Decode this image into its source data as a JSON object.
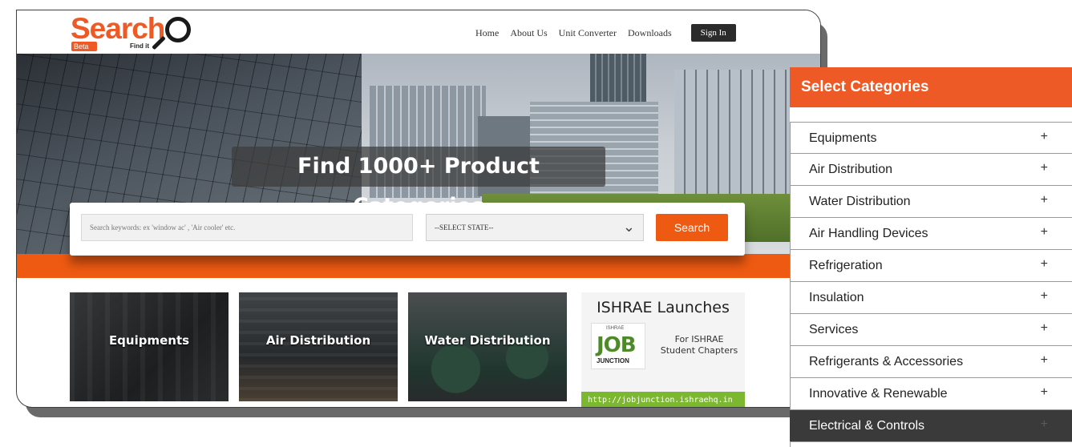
{
  "site": {
    "logo_text": "Search",
    "logo_badge": "Beta",
    "logo_tagline": "Find it"
  },
  "nav": {
    "items": [
      "Home",
      "About Us",
      "Unit Converter",
      "Downloads"
    ],
    "sign_in": "Sign In"
  },
  "hero": {
    "title": "Find 1000+ Product Categories"
  },
  "search": {
    "placeholder": "Search keywords: ex 'window ac' , 'Air cooler' etc.",
    "state_selected": "--SELECT STATE--",
    "button_label": "Search"
  },
  "cards": [
    {
      "label": "Equipments"
    },
    {
      "label": "Air Distribution"
    },
    {
      "label": "Water Distribution"
    }
  ],
  "ad": {
    "title": "ISHRAE Launches",
    "logo_small": "ISHRAE",
    "logo_job": "JOB",
    "logo_junction": "JUNCTION",
    "subtitle_line1": "For ISHRAE",
    "subtitle_line2": "Student Chapters",
    "link": "http://jobjunction.ishraehq.in"
  },
  "categories": {
    "title": "Select Categories",
    "items": [
      {
        "label": "Equipments",
        "icon": "+"
      },
      {
        "label": "Air Distribution",
        "icon": "+"
      },
      {
        "label": "Water Distribution",
        "icon": "+"
      },
      {
        "label": "Air Handling Devices",
        "icon": "+"
      },
      {
        "label": "Refrigeration",
        "icon": "+"
      },
      {
        "label": "Insulation",
        "icon": "+"
      },
      {
        "label": "Services",
        "icon": "+"
      },
      {
        "label": "Refrigerants & Accessories",
        "icon": "+"
      },
      {
        "label": "Innovative & Renewable",
        "icon": "+"
      },
      {
        "label": "Electrical & Controls",
        "icon": "+"
      }
    ],
    "active_index": 9
  },
  "colors": {
    "accent": "#ee5a25",
    "band": "#ee5a12",
    "ad_green": "#7cb82f",
    "active_row": "#3a3a3a"
  }
}
